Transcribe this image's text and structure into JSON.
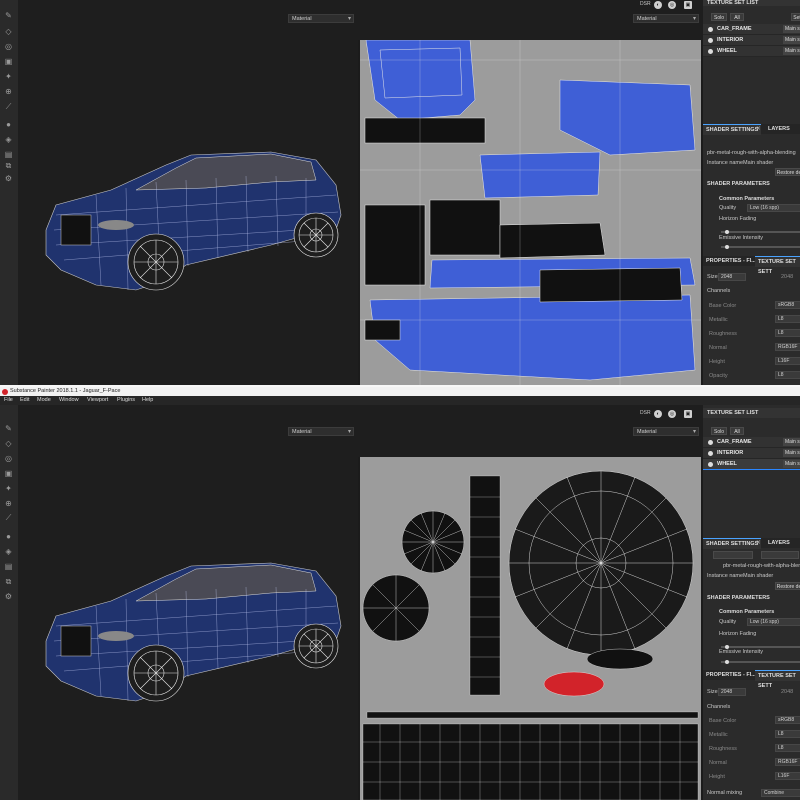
{
  "app": {
    "title": "Substance Painter 2018.1.1 - Jaguar_F-Pace",
    "menu": [
      "File",
      "Edit",
      "Mode",
      "Window",
      "Viewport",
      "Plugins",
      "Help"
    ]
  },
  "topicons": {
    "dsr": "DSR"
  },
  "viewport": {
    "material_mode_3d": "Material",
    "material_mode_2d": "Material"
  },
  "texture_set_list": {
    "title": "TEXTURE SET LIST",
    "solo": "Solo",
    "all": "All",
    "set_button_partial": "Set",
    "items": [
      {
        "name": "CAR_FRAME",
        "shader": "Main sh"
      },
      {
        "name": "INTERIOR",
        "shader": "Main sh"
      },
      {
        "name": "WHEEL",
        "shader": "Main sh"
      }
    ]
  },
  "shader_settings": {
    "tab_shader": "SHADER SETTINGS",
    "tab_layers": "LAYERS",
    "shader_name": "pbr-metal-rough-with-alpha-blending",
    "instance_label": "Instance name",
    "instance_value": "Main shader",
    "restore_button": "Restore de",
    "params_title": "SHADER PARAMETERS",
    "common_title": "Common Parameters",
    "quality_label": "Quality",
    "quality_value": "Low (16 spp)",
    "horizon_label": "Horizon Fading",
    "emissive_label": "Emissive Intensity",
    "horizon_level": 0.05,
    "emissive_level": 0.05
  },
  "properties": {
    "tab_properties": "PROPERTIES - FI...",
    "tab_texture": "TEXTURE SET SETT",
    "size_label": "Size",
    "size_value": "2048",
    "size_value2": "2048",
    "channels_title": "Channels",
    "channels": [
      {
        "name": "Base Color",
        "format": "sRGB8"
      },
      {
        "name": "Metallic",
        "format": "L8"
      },
      {
        "name": "Roughness",
        "format": "L8"
      },
      {
        "name": "Normal",
        "format": "RGB16F"
      },
      {
        "name": "Height",
        "format": "L16F"
      },
      {
        "name": "Opacity",
        "format": "L8"
      }
    ],
    "normal_mixing_label": "Normal mixing",
    "normal_mixing_value": "Combine"
  },
  "colors": {
    "accent": "#2a86ff",
    "uv_blue": "#3f5fd6",
    "uv_background": "#9c9c9c",
    "car_body": "#20336e"
  }
}
